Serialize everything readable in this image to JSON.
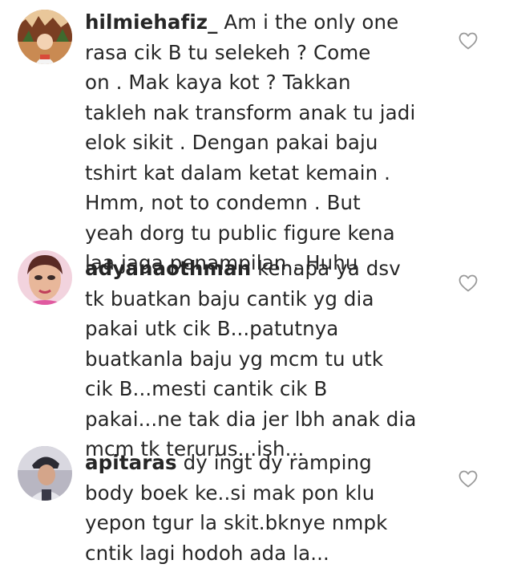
{
  "comments": [
    {
      "username": "hilmiehafiz_",
      "text": " Am i the only one\nrasa cik B tu selekeh ? Come\non . Mak kaya kot ? Takkan\ntakleh nak transform anak tu jadi\nelok sikit . Dengan pakai baju\ntshirt kat dalam ketat kemain .\nHmm, not to condemn . But\nyeah dorg tu public figure kena\nlaa jaga penampilan . Huhu"
    },
    {
      "username": "adyanaothman",
      "text": " kenapa ya dsv\ntk buatkan baju cantik yg dia\npakai utk cik B...patutnya\nbuatkanla baju yg mcm tu utk\ncik B...mesti cantik cik B\npakai...ne tak dia jer lbh anak dia\nmcm tk terurus...ish..."
    },
    {
      "username": "apitaras",
      "text": " dy ingt dy ramping\nbody boek ke..si mak pon klu\nyepon tgur la skit.bknye nmpk\ncntik lagi hodoh ada la..."
    }
  ],
  "icons": {
    "avatar": "profile-avatar",
    "like": "heart-outline-icon"
  },
  "colors": {
    "text": "#262626",
    "heart": "#999999",
    "background": "#ffffff"
  }
}
